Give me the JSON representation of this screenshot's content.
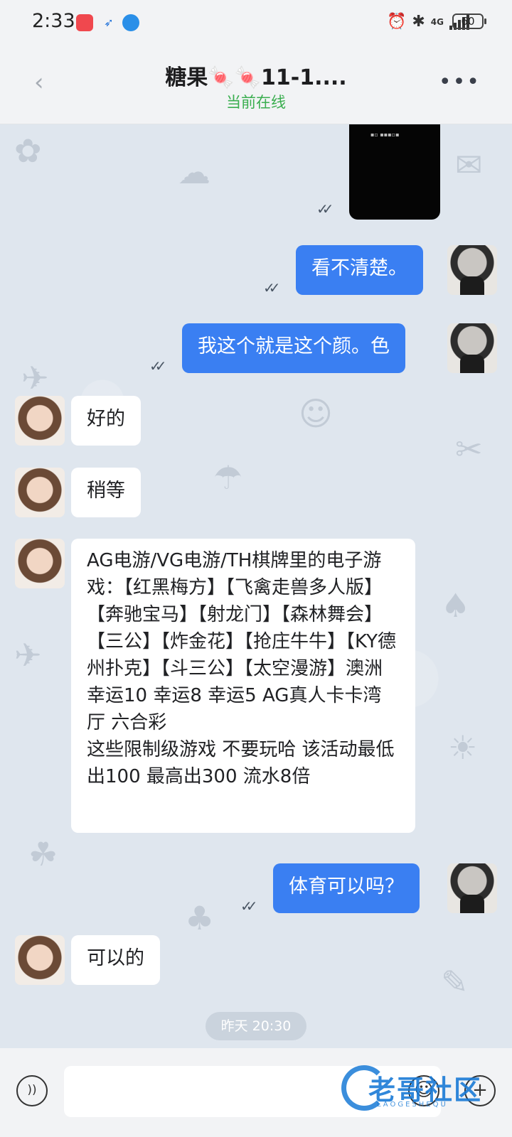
{
  "status_bar": {
    "time": "2:33",
    "network": "4G",
    "battery": "60"
  },
  "header": {
    "title": "糖果🍬🍬11-1....",
    "status": "当前在线",
    "back_icon": "chevron-left-icon",
    "more_icon": "more-dots-icon",
    "status_color": "#3aae4f"
  },
  "messages": [
    {
      "direction": "out",
      "type": "image"
    },
    {
      "direction": "out",
      "text": "看不清楚。"
    },
    {
      "direction": "out",
      "text": "我这个就是这个颜。色"
    },
    {
      "direction": "in",
      "text": "好的"
    },
    {
      "direction": "in",
      "text": "稍等"
    },
    {
      "direction": "in",
      "text": "AG电游/VG电游/TH棋牌里的电子游戏：【红黑梅方】【飞禽走兽多人版】【奔驰宝马】【射龙门】【森林舞会】【三公】【炸金花】【抢庄牛牛】【KY德州扑克】【斗三公】【太空漫游】澳洲幸运10 幸运8 幸运5 AG真人卡卡湾厅 六合彩\n这些限制级游戏 不要玩哈 该活动最低出100 最高出300 流水8倍"
    },
    {
      "direction": "out",
      "text": "体育可以吗？"
    },
    {
      "direction": "in",
      "text": "可以的"
    }
  ],
  "date_divider": "昨天 20:30",
  "input": {
    "placeholder": "",
    "voice_icon": "voice-icon",
    "emoji_icon": "emoji-icon",
    "plus_icon": "plus-icon"
  },
  "watermark": {
    "text": "老哥社区",
    "sub": "LAOGESHEQU"
  },
  "colors": {
    "outgoing_bubble": "#3a7ff2",
    "incoming_bubble": "#ffffff",
    "chat_background": "#dfe6ee"
  }
}
